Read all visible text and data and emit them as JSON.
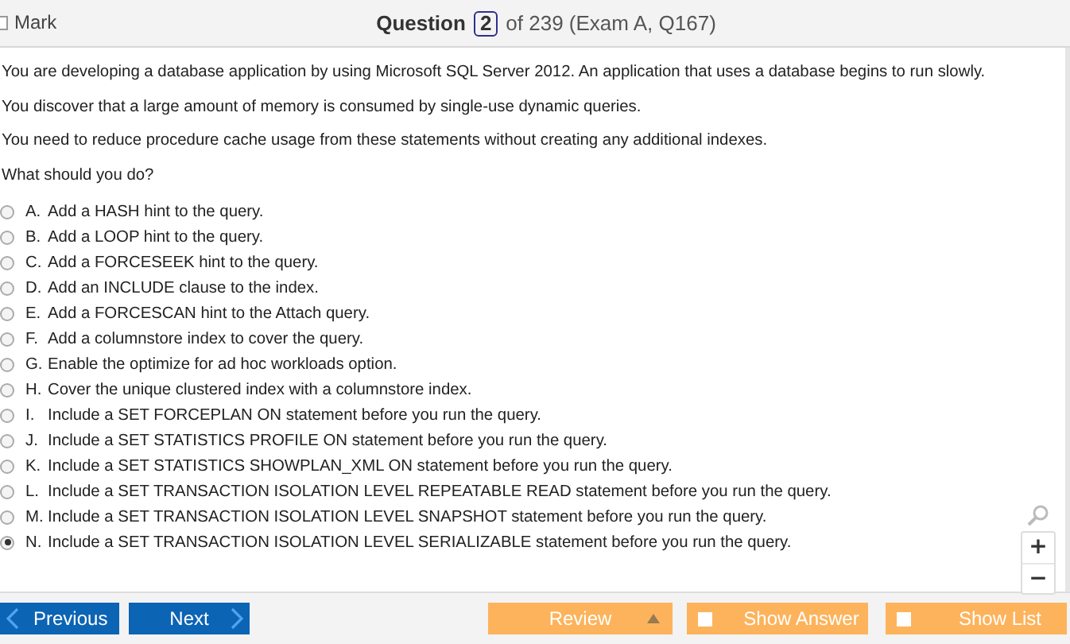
{
  "header": {
    "mark": {
      "label": "Mark",
      "checked": false
    },
    "question_label": "Question",
    "question_number": "2",
    "question_total": "of 239 (Exam A, Q167)"
  },
  "question": {
    "paragraphs": [
      "You are developing a database application by using Microsoft SQL Server 2012. An application that uses a database begins to run slowly.",
      "You discover that a large amount of memory is consumed by single-use dynamic queries.",
      "You need to reduce procedure cache usage from these statements without creating any additional indexes.",
      "What should you do?"
    ],
    "options": [
      {
        "letter": "A.",
        "text": "Add a HASH hint to the query.",
        "selected": false
      },
      {
        "letter": "B.",
        "text": "Add a LOOP hint to the query.",
        "selected": false
      },
      {
        "letter": "C.",
        "text": "Add a FORCESEEK hint to the query.",
        "selected": false
      },
      {
        "letter": "D.",
        "text": "Add an INCLUDE clause to the index.",
        "selected": false
      },
      {
        "letter": "E.",
        "text": "Add a FORCESCAN hint to the Attach query.",
        "selected": false
      },
      {
        "letter": "F.",
        "text": "Add a columnstore index to cover the query.",
        "selected": false
      },
      {
        "letter": "G.",
        "text": "Enable the optimize for ad hoc workloads option.",
        "selected": false
      },
      {
        "letter": "H.",
        "text": "Cover the unique clustered index with a columnstore index.",
        "selected": false
      },
      {
        "letter": "I.",
        "text": "Include a SET FORCEPLAN ON statement before you run the query.",
        "selected": false
      },
      {
        "letter": "J.",
        "text": "Include a SET STATISTICS PROFILE ON statement before you run the query.",
        "selected": false
      },
      {
        "letter": "K.",
        "text": "Include a SET STATISTICS SHOWPLAN_XML ON statement before you run the query.",
        "selected": false
      },
      {
        "letter": "L.",
        "text": "Include a SET TRANSACTION ISOLATION LEVEL REPEATABLE READ statement before you run the query.",
        "selected": false
      },
      {
        "letter": "M.",
        "text": "Include a SET TRANSACTION ISOLATION LEVEL SNAPSHOT statement before you run the query.",
        "selected": false
      },
      {
        "letter": "N.",
        "text": "Include a SET TRANSACTION ISOLATION LEVEL SERIALIZABLE statement before you run the query.",
        "selected": true
      }
    ]
  },
  "zoom_controls": {
    "zoom_in": "+",
    "zoom_out": "−"
  },
  "footer": {
    "previous": "Previous",
    "next": "Next",
    "review": "Review",
    "show_answer": {
      "label": "Show Answer",
      "checked": false
    },
    "show_list": {
      "label": "Show List",
      "checked": false
    }
  }
}
